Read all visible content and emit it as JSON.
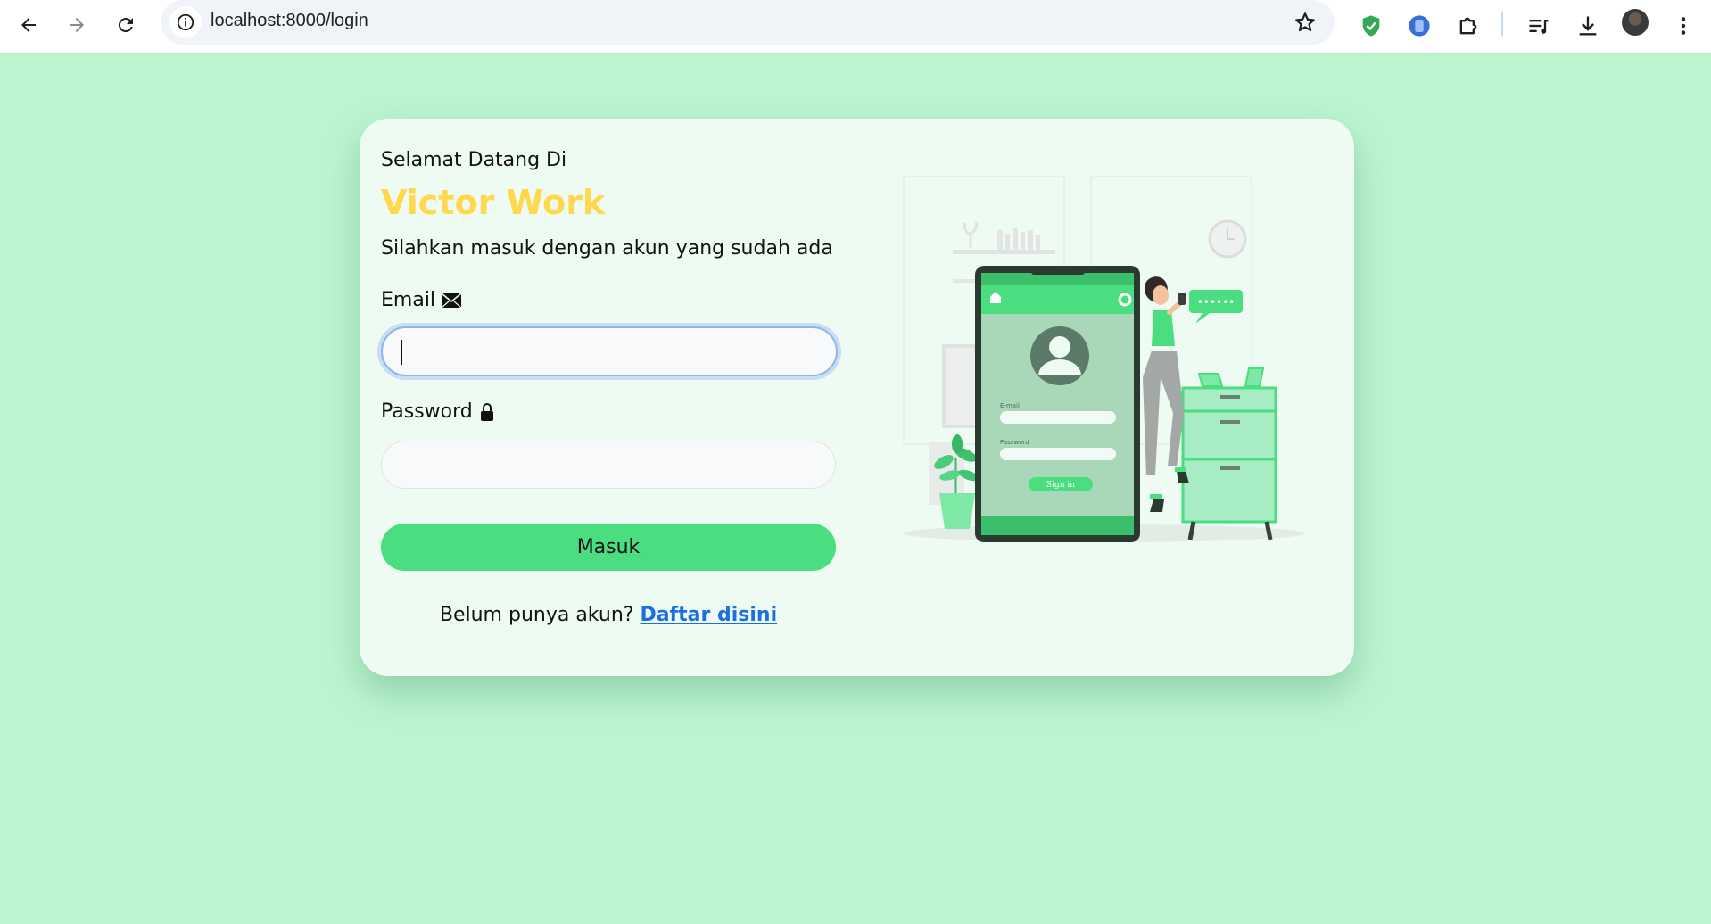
{
  "browser": {
    "url": "localhost:8000/login",
    "icons": [
      "back-arrow-icon",
      "forward-arrow-icon",
      "reload-icon",
      "site-info-icon",
      "bookmark-star-icon",
      "shield-extension-icon",
      "blue-extension-icon",
      "puzzle-extensions-icon",
      "media-control-icon",
      "download-icon",
      "profile-avatar",
      "more-menu-icon"
    ]
  },
  "login": {
    "welcome": "Selamat Datang Di",
    "brand": "Victor Work",
    "subtitle": "Silahkan masuk dengan akun yang sudah ada",
    "email_label": "Email",
    "email_value": "",
    "password_label": "Password",
    "password_value": "",
    "submit_label": "Masuk",
    "signup_prompt": "Belum punya akun?",
    "signup_link": "Daftar disini"
  },
  "illustration": {
    "email_field_label": "E-mail",
    "password_field_label": "Password",
    "sign_in_label": "Sign in",
    "chat_bubble_text": "••••••"
  },
  "colors": {
    "page_bg": "#bbf5d0",
    "card_bg": "#eefbf3",
    "brand": "#ffd84d",
    "button": "#4ade80",
    "link": "#1d6fe0"
  }
}
